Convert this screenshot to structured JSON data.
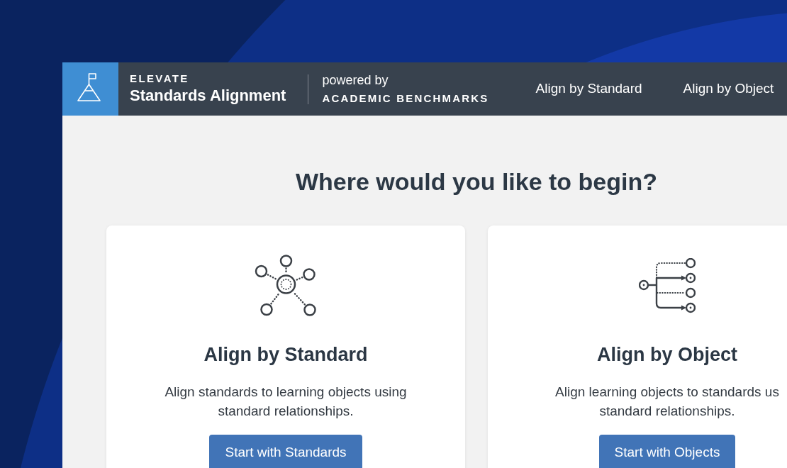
{
  "header": {
    "brand": "ELEVATE",
    "product": "Standards Alignment",
    "powered_by": "powered by",
    "partner": "ACADEMIC BENCHMARKS",
    "nav": [
      {
        "label": "Align by Standard"
      },
      {
        "label": "Align by Object"
      }
    ]
  },
  "heading": "Where would you like to begin?",
  "cards": [
    {
      "kind": "standard",
      "title": "Align by Standard",
      "description_lines": [
        "Align standards to learning objects using",
        "standard relationships."
      ],
      "button": "Start with Standards"
    },
    {
      "kind": "object",
      "title": "Align by Object",
      "description_lines": [
        "Align learning objects to standards us",
        "standard relationships."
      ],
      "button": "Start with Objects"
    }
  ]
}
